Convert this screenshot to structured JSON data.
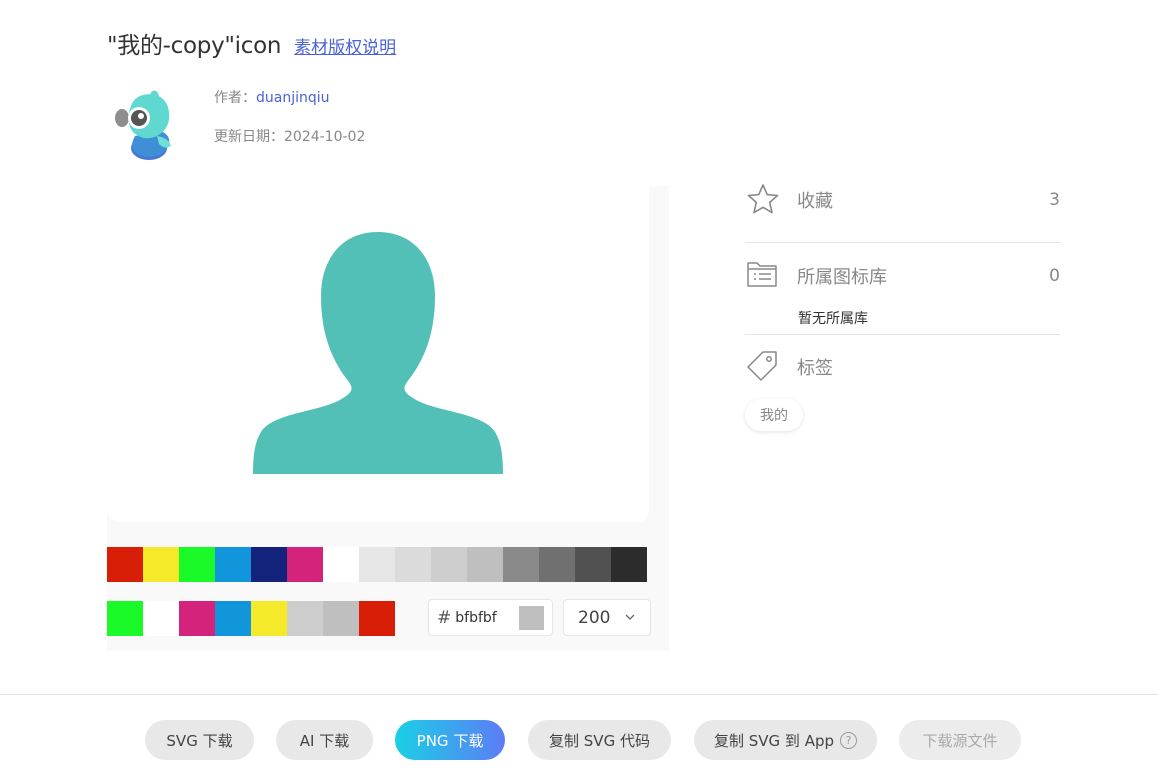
{
  "header": {
    "title": "\"我的-copy\"icon",
    "copyright_link": "素材版权说明"
  },
  "author": {
    "label": "作者：",
    "name": "duanjinqiu",
    "date_label": "更新日期：",
    "date": "2024-10-02"
  },
  "preview": {
    "icon_color": "#53c0b8"
  },
  "palette": {
    "row1": [
      "#d81e06",
      "#f4ea2a",
      "#1afa29",
      "#1296db",
      "#13227a",
      "#d4237a",
      "#ffffff",
      "#e6e6e6",
      "#dbdbdb",
      "#cdcdcd",
      "#bfbfbf",
      "#8a8a8a",
      "#707070",
      "#515151",
      "#2c2c2c"
    ],
    "row2": [
      "#1afa29",
      "#ffffff",
      "#d4237a",
      "#1296db",
      "#f4ea2a",
      "#cdcdcd",
      "#bfbfbf",
      "#d81e06"
    ]
  },
  "color_input": {
    "hash": "#",
    "value": "bfbfbf"
  },
  "size_select": {
    "value": "200"
  },
  "sidebar": {
    "favorites": {
      "label": "收藏",
      "count": "3"
    },
    "libraries": {
      "label": "所属图标库",
      "count": "0",
      "empty_text": "暂无所属库"
    },
    "tags": {
      "label": "标签",
      "items": [
        "我的"
      ]
    }
  },
  "buttons": {
    "svg_download": "SVG 下载",
    "ai_download": "AI 下载",
    "png_download": "PNG 下载",
    "copy_svg_code": "复制 SVG 代码",
    "copy_svg_to_app": "复制 SVG 到 App",
    "help_glyph": "?",
    "download_source": "下载源文件"
  }
}
